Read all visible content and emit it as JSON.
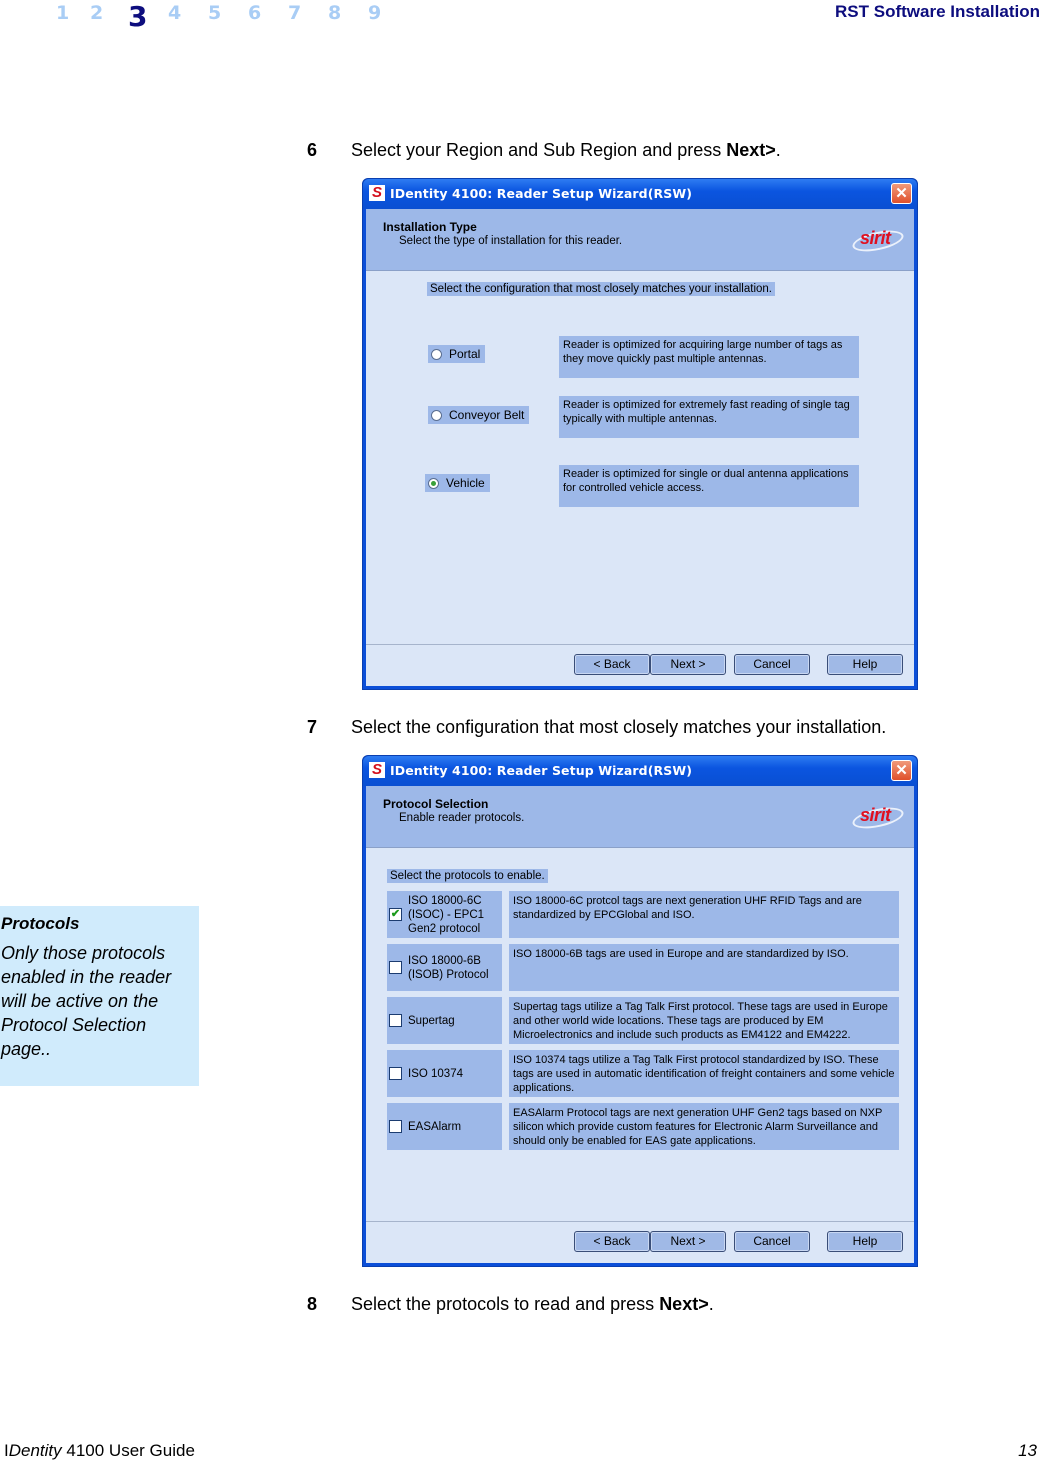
{
  "header": {
    "chapters": [
      "1",
      "2",
      "3",
      "4",
      "5",
      "6",
      "7",
      "8",
      "9"
    ],
    "active_chapter": "3",
    "section_title": "RST Software Installation"
  },
  "steps": [
    {
      "number": "6",
      "text": "Select your Region and Sub Region and press ",
      "bold": "Next>",
      "tail": "."
    },
    {
      "number": "7",
      "text": "Select the configuration that most closely matches your installation.",
      "bold": "",
      "tail": ""
    },
    {
      "number": "8",
      "text": "Select the protocols to read and press ",
      "bold": "Next>",
      "tail": "."
    }
  ],
  "wizard_common": {
    "window_title": "IDentity 4100: Reader Setup Wizard(RSW)",
    "app_icon": "S",
    "close_glyph": "✕",
    "logo_text": "sirit",
    "buttons": {
      "back": "< Back",
      "next": "Next >",
      "cancel": "Cancel",
      "help": "Help"
    }
  },
  "wizard_installation": {
    "banner_title": "Installation Type",
    "banner_subtitle": "Select the type of installation for this reader.",
    "prompt": "Select the configuration that most closely matches your installation.",
    "options": [
      {
        "label": "Portal",
        "selected": false,
        "description": "Reader is optimized for acquiring large number of tags as they move quickly past multiple antennas."
      },
      {
        "label": "Conveyor Belt",
        "selected": false,
        "description": "Reader is optimized for extremely fast reading of single tag typically with multiple antennas."
      },
      {
        "label": "Vehicle",
        "selected": true,
        "description": "Reader is optimized for single or dual antenna applications for controlled vehicle access."
      }
    ]
  },
  "wizard_protocols": {
    "banner_title": "Protocol Selection",
    "banner_subtitle": "Enable reader protocols.",
    "prompt": "Select the protocols to enable.",
    "protocols": [
      {
        "label": "ISO 18000-6C (ISOC) - EPC1 Gen2 protocol",
        "checked": true,
        "description": "ISO 18000-6C protcol tags are next generation UHF RFID Tags and are standardized by EPCGlobal and ISO."
      },
      {
        "label": "ISO 18000-6B (ISOB) Protocol",
        "checked": false,
        "description": "ISO 18000-6B tags are used in Europe and are standardized by ISO."
      },
      {
        "label": "Supertag",
        "checked": false,
        "description": "Supertag tags utilize a Tag Talk First protocol. These tags are used in Europe and other world wide locations. These tags are produced by EM Microelectronics and include such products as EM4122 and EM4222."
      },
      {
        "label": "ISO 10374",
        "checked": false,
        "description": "ISO 10374 tags utilize a Tag Talk First protocol standardized by ISO. These tags are used in automatic identification of freight containers and some vehicle applications."
      },
      {
        "label": "EASAlarm",
        "checked": false,
        "description": "EASAlarm Protocol tags are next generation UHF Gen2 tags based on NXP silicon which provide custom features for Electronic Alarm Surveillance and should only be enabled for EAS gate applications."
      }
    ],
    "check_glyph": "✔"
  },
  "note": {
    "title": "Protocols",
    "body": "Only those protocols enabled in the reader will be active on the Protocol Selection page.."
  },
  "footer": {
    "guide_prefix": "I",
    "guide_italic": "Dentity",
    "guide_suffix": " 4100 User Guide",
    "page_number": "13"
  }
}
